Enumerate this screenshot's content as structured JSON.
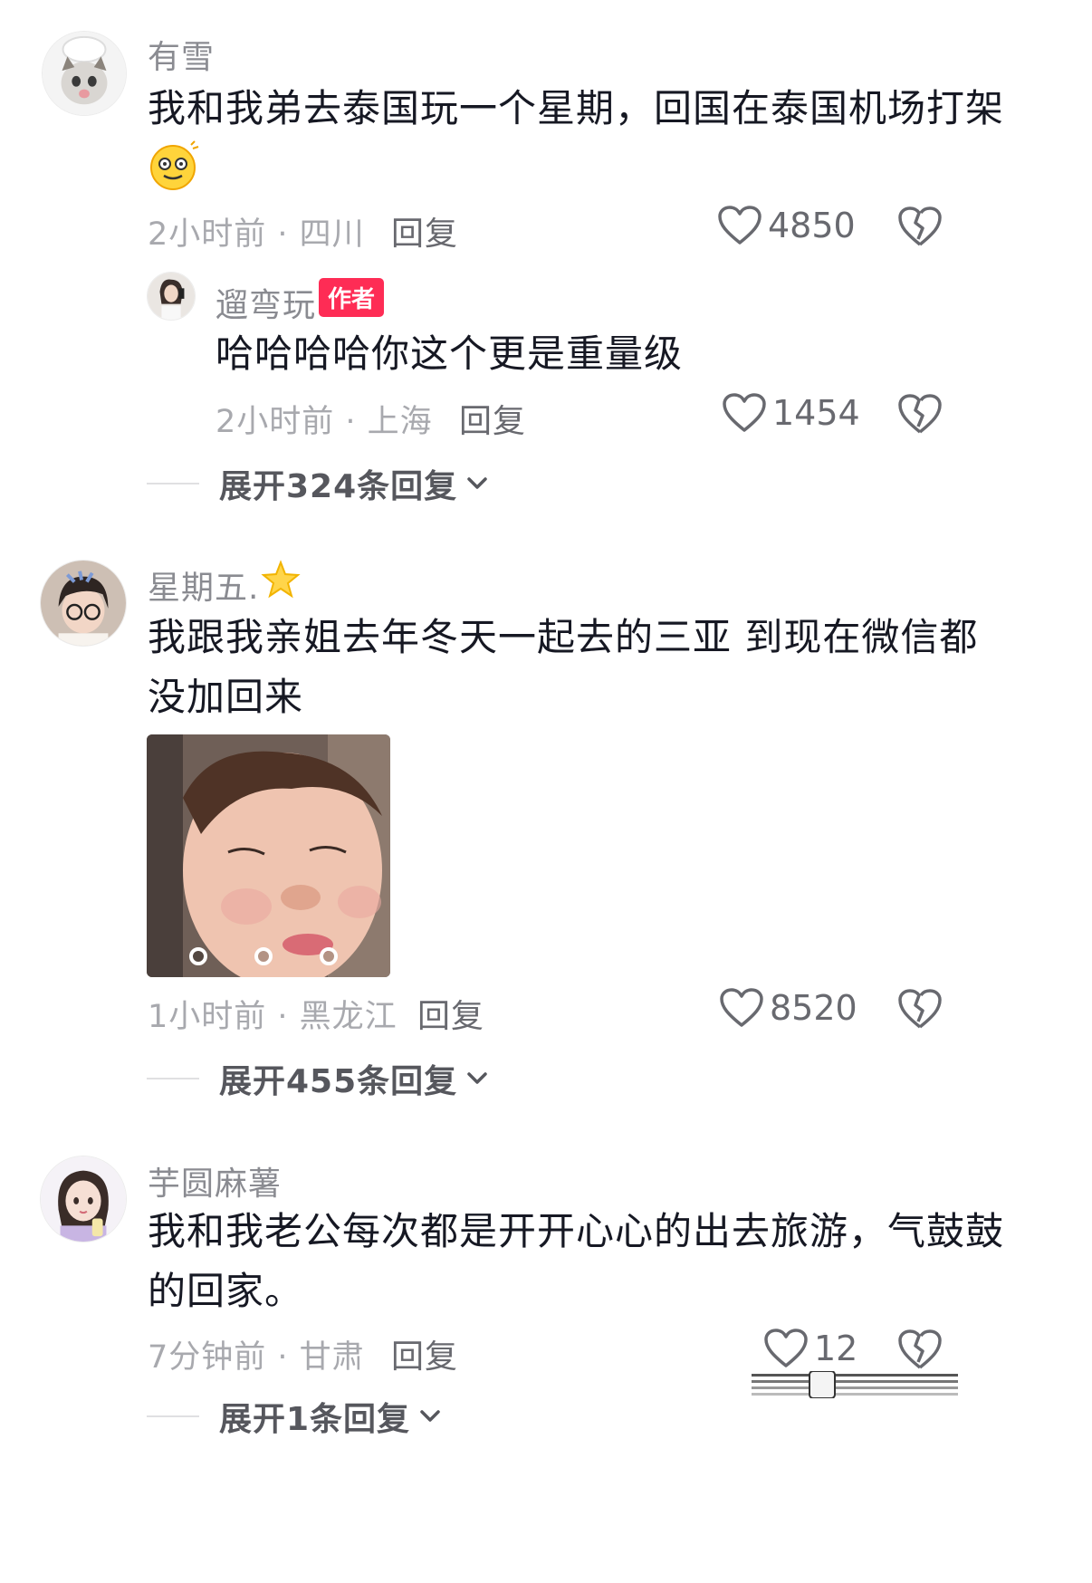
{
  "comments": [
    {
      "username": "有雪",
      "content_line1": "我和我弟去泰国玩一个星期，回国在泰国机场打架",
      "emoji": "dizzy-face-emoji",
      "meta": "2小时前 · 四川",
      "reply_label": "回复",
      "likes": "4850",
      "reply": {
        "username": "遛弯玩",
        "badge": "作者",
        "content": "哈哈哈哈你这个更是重量级",
        "meta": "2小时前 · 上海",
        "reply_label": "回复",
        "likes": "1454"
      },
      "expand_label": "展开324条回复"
    },
    {
      "username": "星期五.",
      "username_emoji": "star-icon",
      "content_line1": "我跟我亲姐去年冬天一起去的三亚 到现在微信都",
      "content_line2": "没加回来",
      "photo": "sleeping-child-photo",
      "meta": "1小时前 · 黑龙江",
      "reply_label": "回复",
      "likes": "8520",
      "expand_label": "展开455条回复"
    },
    {
      "username": "芋圆麻薯",
      "content_line1": "我和我老公每次都是开开心心的出去旅游，气鼓鼓",
      "content_line2": "的回家。",
      "meta": "7分钟前 · 甘肃",
      "reply_label": "回复",
      "likes": "12",
      "expand_label": "展开1条回复"
    }
  ],
  "colors": {
    "text_primary": "#161823",
    "text_secondary": "#8a8b91",
    "accent_badge": "#fe2c55"
  }
}
